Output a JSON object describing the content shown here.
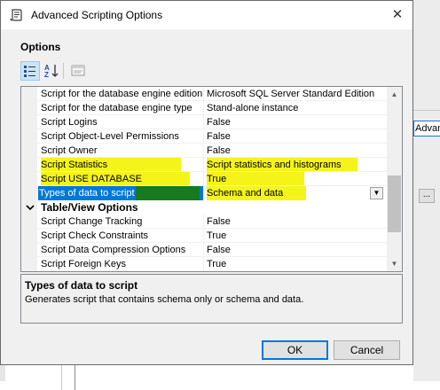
{
  "window": {
    "title": "Advanced Scripting Options",
    "close_glyph": "✕"
  },
  "section_title": "Options",
  "toolbar": {
    "categorized_icon": "categorized-icon",
    "alphabetical_icon": "alphabetical-icon",
    "property_pages_icon": "property-pages-icon"
  },
  "grid": {
    "rows": [
      {
        "name": "Script for the database engine edition",
        "value": "Microsoft SQL Server Standard Edition"
      },
      {
        "name": "Script for the database engine type",
        "value": "Stand-alone instance"
      },
      {
        "name": "Script Logins",
        "value": "False"
      },
      {
        "name": "Script Object-Level Permissions",
        "value": "False"
      },
      {
        "name": "Script Owner",
        "value": "False"
      },
      {
        "name": "Script Statistics",
        "value": "Script statistics and histograms"
      },
      {
        "name": "Script USE DATABASE",
        "value": "True"
      },
      {
        "name": "Types of data to script",
        "value": "Schema and data"
      },
      {
        "name": "Table/View Options",
        "value": ""
      },
      {
        "name": "Script Change Tracking",
        "value": "False"
      },
      {
        "name": "Script Check Constraints",
        "value": "True"
      },
      {
        "name": "Script Data Compression Options",
        "value": "False"
      },
      {
        "name": "Script Foreign Keys",
        "value": "True"
      }
    ],
    "category_chevron": "❯"
  },
  "description": {
    "title": "Types of data to script",
    "text": "Generates script that contains schema only or schema and data."
  },
  "buttons": {
    "ok": "OK",
    "cancel": "Cancel"
  },
  "background": {
    "partial_button": "Advanced",
    "dots_button": "..."
  },
  "colors": {
    "highlight": "#f4f41b",
    "selection": "#0078d7",
    "accent_green": "#177a1f"
  }
}
